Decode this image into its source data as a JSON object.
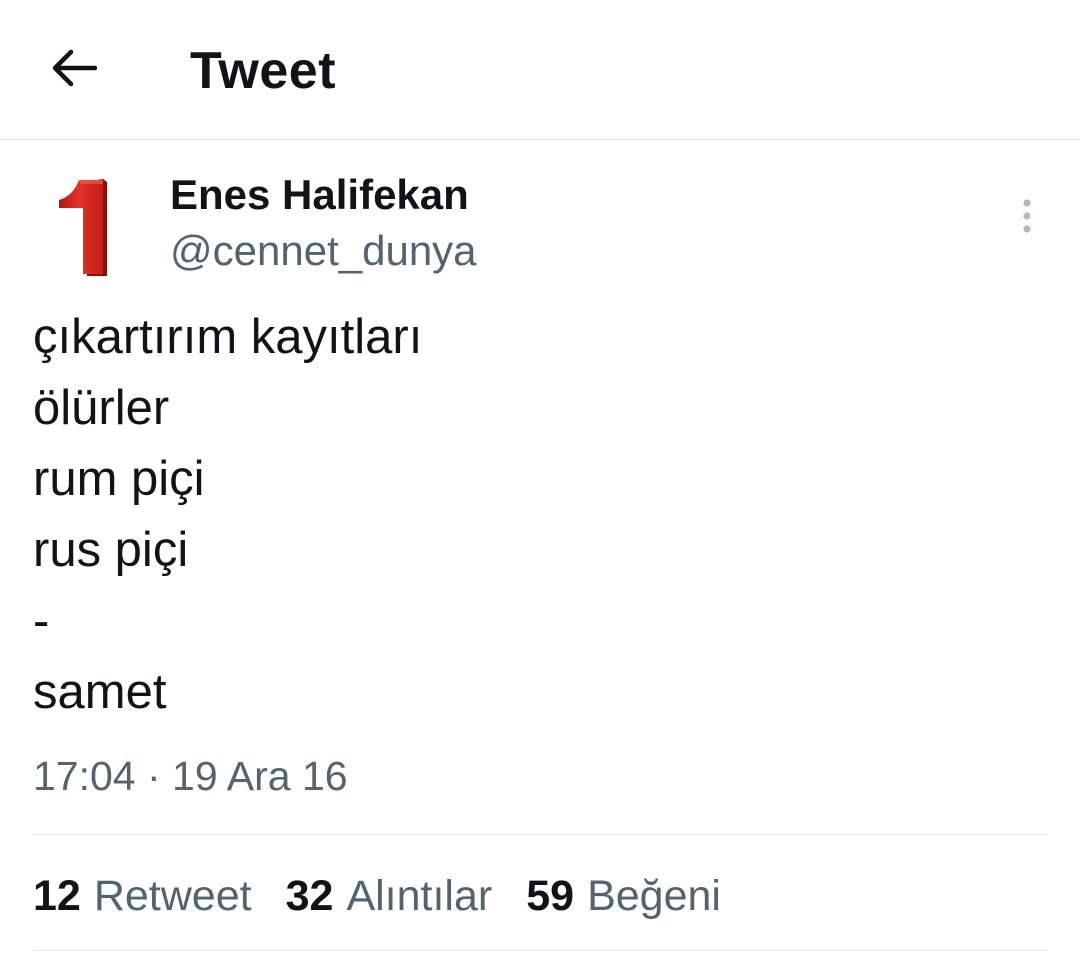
{
  "header": {
    "title": "Tweet",
    "back_icon": "arrow-left-icon"
  },
  "author": {
    "name": "Enes Halifekan",
    "handle": "@cennet_dunya",
    "avatar_glyph": "1",
    "avatar_color": "#d8261c"
  },
  "tweet": {
    "text": "çıkartırım kayıtları\nölürler\nrum piçi\nrus piçi\n-\nsamet",
    "timestamp": "17:04 · 19 Ara 16"
  },
  "stats": [
    {
      "count": "12",
      "label": "Retweet"
    },
    {
      "count": "32",
      "label": "Alıntılar"
    },
    {
      "count": "59",
      "label": "Beğeni"
    }
  ],
  "colors": {
    "text_primary": "#0f1419",
    "text_secondary": "#536471",
    "border": "#e6e9eb",
    "menu_dots": "#b0b9c2"
  },
  "icons": {
    "more": "more-vertical-icon"
  }
}
